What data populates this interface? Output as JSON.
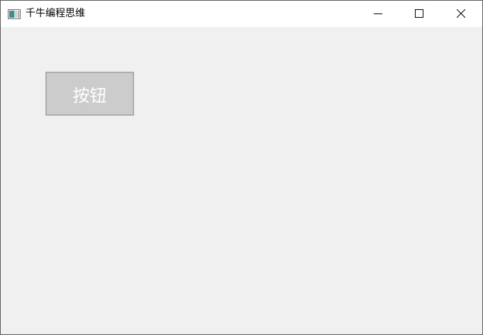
{
  "window": {
    "title": "千牛编程思维",
    "icon": "app-window-icon",
    "controls": {
      "minimize_icon": "minimize-icon",
      "maximize_icon": "maximize-icon",
      "close_icon": "close-icon"
    }
  },
  "main": {
    "button_label": "按钮"
  },
  "colors": {
    "client_background": "#f0f0f0",
    "titlebar_background": "#ffffff",
    "button_background": "#cccccc",
    "button_border": "#adadad",
    "button_text": "#ffffff"
  }
}
